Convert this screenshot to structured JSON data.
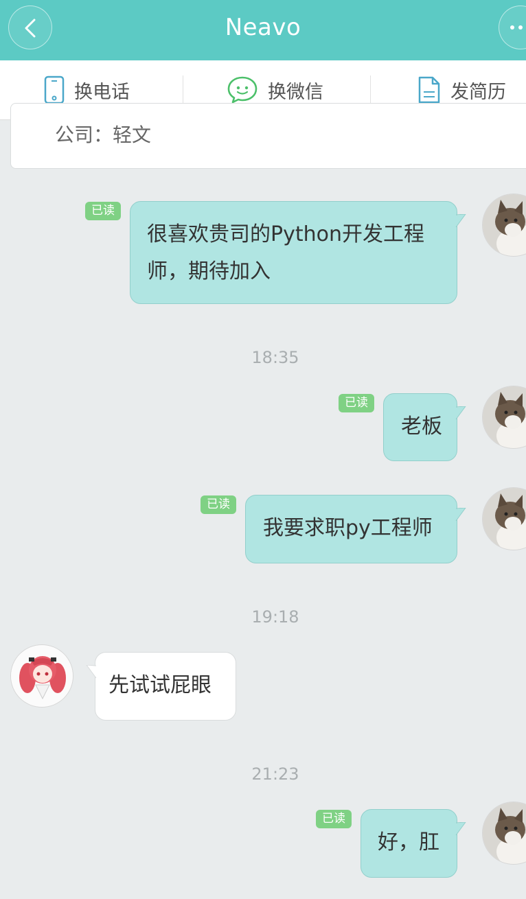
{
  "header": {
    "title": "Neavo"
  },
  "actions": [
    {
      "label": "换电话",
      "icon": "phone-icon"
    },
    {
      "label": "换微信",
      "icon": "wechat-icon"
    },
    {
      "label": "发简历",
      "icon": "resume-icon"
    }
  ],
  "company_card": {
    "text": "公司：轻文"
  },
  "read_label": "已读",
  "messages": [
    {
      "sender": "me",
      "line1": "很喜欢贵司的Python开发工程",
      "line2": "师，期待加入",
      "read": true
    },
    {
      "timestamp": "18:35"
    },
    {
      "sender": "me",
      "text": "老板",
      "read": true
    },
    {
      "sender": "me",
      "text": "我要求职py工程师",
      "read": true
    },
    {
      "timestamp": "19:18"
    },
    {
      "sender": "other",
      "text": "先试试屁眼"
    },
    {
      "timestamp": "21:23"
    },
    {
      "sender": "me",
      "text": "好，肛",
      "read": true
    }
  ],
  "colors": {
    "header": "#5ccac4",
    "mine_bubble": "#b0e5e2",
    "read_badge": "#7fd184",
    "background": "#e9eced"
  }
}
